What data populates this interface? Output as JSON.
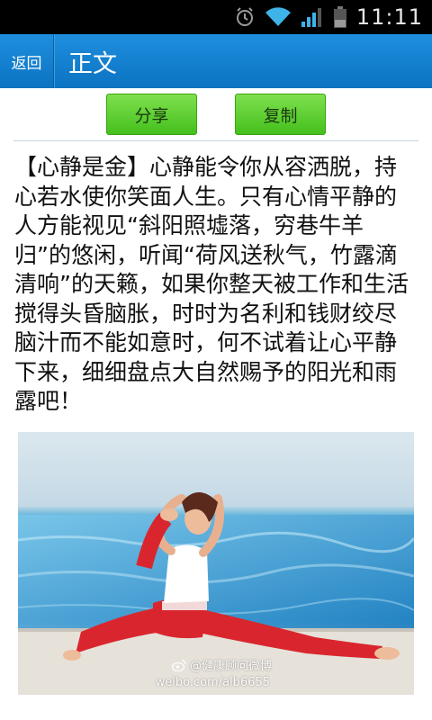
{
  "status_bar": {
    "time": "11:11",
    "icons": [
      "alarm-icon",
      "wifi-icon",
      "signal-icon",
      "battery-icon"
    ]
  },
  "header": {
    "back_label": "返回",
    "title": "正文",
    "color": "#0b73c2"
  },
  "actions": {
    "share_label": "分享",
    "copy_label": "复制",
    "button_color": "#44c01d"
  },
  "article": {
    "text": "【心静是金】心静能令你从容洒脱，持心若水使你笑面人生。只有心情平静的人方能视见“斜阳照墟落，穷巷牛羊归”的悠闲，听闻“荷风送秋气，竹露滴清响”的天籁，如果你整天被工作和生活搅得头昏脑胀，时时为名利和钱财绞尽脑汁而不能如意时，何不试着让心平静下来，细细盘点大自然赐予的阳光和雨露吧！"
  },
  "photo": {
    "description_icon": "yoga-photo",
    "watermark_name": "@健康顾问微博",
    "watermark_url": "weibo.com/alb6655"
  }
}
